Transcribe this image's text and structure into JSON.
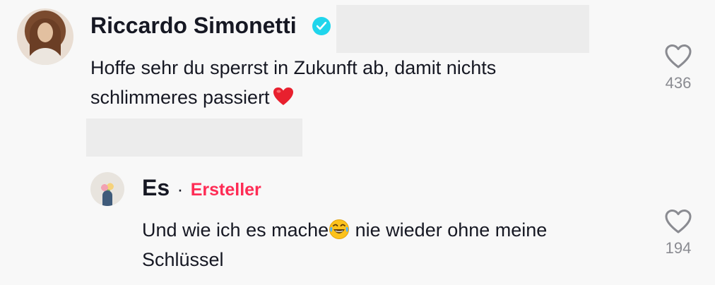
{
  "comment": {
    "username": "Riccardo Simonetti",
    "text_line1": "Hoffe sehr du sperrst in Zukunft ab, damit nichts",
    "text_line2": "schlimmeres passiert",
    "like_count": "436",
    "emoji": "heart-emoji"
  },
  "reply": {
    "username": "Es",
    "separator": "·",
    "creator_label": "Ersteller",
    "text_line1_part1": "Und wie ich es mache",
    "text_line1_part2": " nie wieder ohne meine",
    "text_line2": "Schlüssel",
    "like_count": "194",
    "emoji": "laughing-tears-emoji"
  },
  "colors": {
    "verified": "#20d5ec",
    "creator": "#fe2c55",
    "count": "#8a8b91",
    "redaction": "#ececec"
  }
}
